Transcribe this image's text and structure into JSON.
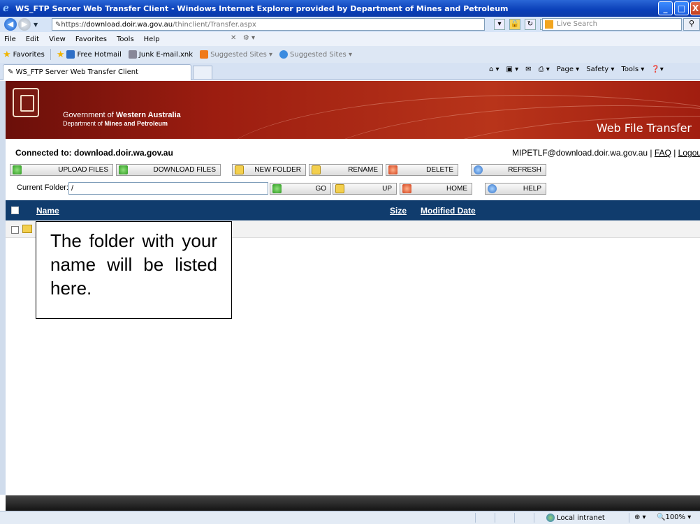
{
  "window": {
    "title": "WS_FTP Server Web Transfer Client - Windows Internet Explorer provided by Department of Mines and Petroleum",
    "buttons": [
      "_",
      "□",
      "X"
    ]
  },
  "address_bar": {
    "url_scheme": "https://",
    "url_host": "download.doir.wa.gov.au",
    "url_path": "/thinclient/Transfer.aspx",
    "search_placeholder": "Live Search"
  },
  "menu": {
    "items": [
      "File",
      "Edit",
      "View",
      "Favorites",
      "Tools",
      "Help"
    ]
  },
  "favorites_bar": {
    "label": "Favorites",
    "items": [
      "Free Hotmail",
      "Junk E-mail.xnk",
      "Suggested Sites ▾",
      "Suggested Sites ▾"
    ]
  },
  "tab": {
    "label": "WS_FTP Server Web Transfer Client"
  },
  "command_bar": {
    "items": [
      "Page ▾",
      "Safety ▾",
      "Tools ▾"
    ]
  },
  "banner": {
    "org_line1_prefix": "Government of ",
    "org_line1_bold": "Western Australia",
    "org_line2_prefix": "Department of ",
    "org_line2_bold": "Mines and Petroleum",
    "app_title": "Web File Transfer"
  },
  "connection": {
    "connected_text": "Connected to: download.doir.wa.gov.au",
    "user": "MIPETLF@download.doir.wa.gov.au",
    "sep1": " | ",
    "faq": "FAQ",
    "sep2": " | ",
    "logout": "Logout"
  },
  "toolbar": {
    "upload": "UPLOAD FILES",
    "download": "DOWNLOAD FILES",
    "new_folder": "NEW FOLDER",
    "rename": "RENAME",
    "delete": "DELETE",
    "refresh": "REFRESH",
    "go": "GO",
    "up": "UP",
    "home": "HOME",
    "help": "HELP"
  },
  "current_folder": {
    "label": "Current Folder:",
    "value": "/"
  },
  "file_list": {
    "columns": [
      "Name",
      "Size",
      "Modified Date"
    ]
  },
  "callout": {
    "text": "The folder with your name will be listed here."
  },
  "status_bar": {
    "zone": "Local intranet",
    "zoom": "100%"
  }
}
